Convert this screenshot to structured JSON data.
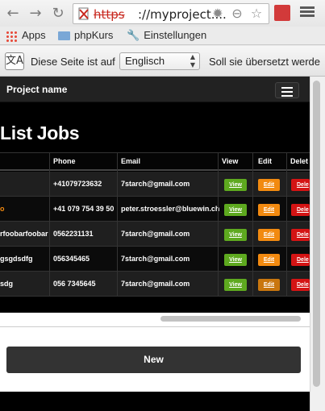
{
  "browser": {
    "url_scheme": "https",
    "url_rest": "://myproject....",
    "back_icon": "back-arrow-icon",
    "forward_icon": "forward-arrow-icon",
    "reload_icon": "reload-icon"
  },
  "bookmarks": {
    "apps": "Apps",
    "folder": "phpKurs",
    "settings": "Einstellungen"
  },
  "translate": {
    "prefix": "Diese Seite ist auf",
    "language": "Englisch",
    "question": "Soll sie übersetzt werde"
  },
  "navbar": {
    "brand": "Project name"
  },
  "page": {
    "heading": "List Jobs"
  },
  "table": {
    "headers": {
      "phone": "Phone",
      "email": "Email",
      "view": "View",
      "edit": "Edit",
      "delete": "Delet"
    },
    "rows": [
      {
        "name": "",
        "phone": "+41079723632",
        "email": "7starch@gmail.com",
        "view": "View",
        "edit": "Edit",
        "delete": "Dele"
      },
      {
        "name": "o",
        "phone": "+41 079 754 39 50",
        "email": "peter.stroessler@bluewin.ch",
        "view": "View",
        "edit": "Edit",
        "delete": "Dele"
      },
      {
        "name": "rfoobarfoobar",
        "phone": "0562231131",
        "email": "7starch@gmail.com",
        "view": "View",
        "edit": "Edit",
        "delete": "Dele"
      },
      {
        "name": "gsgdsdfg",
        "phone": "056345465",
        "email": "7starch@gmail.com",
        "view": "View",
        "edit": "Edit",
        "delete": "Dele"
      },
      {
        "name": "sdg",
        "phone": "056 7345645",
        "email": "7starch@gmail.com",
        "view": "View",
        "edit": "Edit",
        "delete": "Dele"
      }
    ]
  },
  "actions": {
    "new": "New"
  },
  "colors": {
    "view": "#5ea91f",
    "edit": "#f28a10",
    "delete": "#d41414"
  }
}
